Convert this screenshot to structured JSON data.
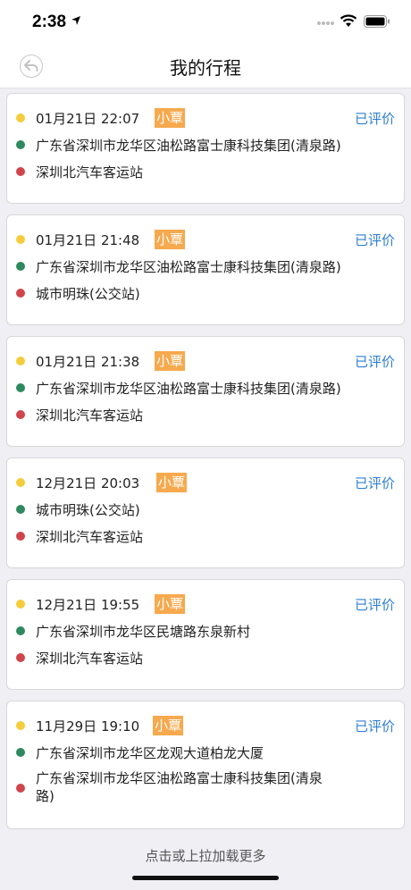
{
  "status_bar": {
    "time": "2:38"
  },
  "nav": {
    "title": "我的行程"
  },
  "trips": [
    {
      "time": "01月21日 22:07",
      "tag": "小覃",
      "status": "已评价",
      "start": "广东省深圳市龙华区油松路富士康科技集团(清泉路)",
      "end": "深圳北汽车客运站"
    },
    {
      "time": "01月21日 21:48",
      "tag": "小覃",
      "status": "已评价",
      "start": "广东省深圳市龙华区油松路富士康科技集团(清泉路)",
      "end": "城市明珠(公交站)"
    },
    {
      "time": "01月21日 21:38",
      "tag": "小覃",
      "status": "已评价",
      "start": "广东省深圳市龙华区油松路富士康科技集团(清泉路)",
      "end": "深圳北汽车客运站"
    },
    {
      "time": "12月21日 20:03",
      "tag": "小覃",
      "status": "已评价",
      "start": "城市明珠(公交站)",
      "end": "深圳北汽车客运站"
    },
    {
      "time": "12月21日 19:55",
      "tag": "小覃",
      "status": "已评价",
      "start": "广东省深圳市龙华区民塘路东泉新村",
      "end": "深圳北汽车客运站"
    },
    {
      "time": "11月29日 19:10",
      "tag": "小覃",
      "status": "已评价",
      "start": "广东省深圳市龙华区龙观大道柏龙大厦",
      "end": "广东省深圳市龙华区油松路富士康科技集团(清泉路)"
    }
  ],
  "footer": {
    "load_more": "点击或上拉加载更多"
  },
  "colors": {
    "accent_link": "#2f7fd1",
    "tag_bg": "#f7a94e",
    "dot_time": "#f5cc3b",
    "dot_start": "#2e8a5e",
    "dot_end": "#d0454b"
  },
  "icons": {
    "back": "back-arrow-circle-icon",
    "location": "location-arrow-icon",
    "signal": "cell-signal-icon",
    "wifi": "wifi-icon",
    "battery": "battery-icon"
  }
}
